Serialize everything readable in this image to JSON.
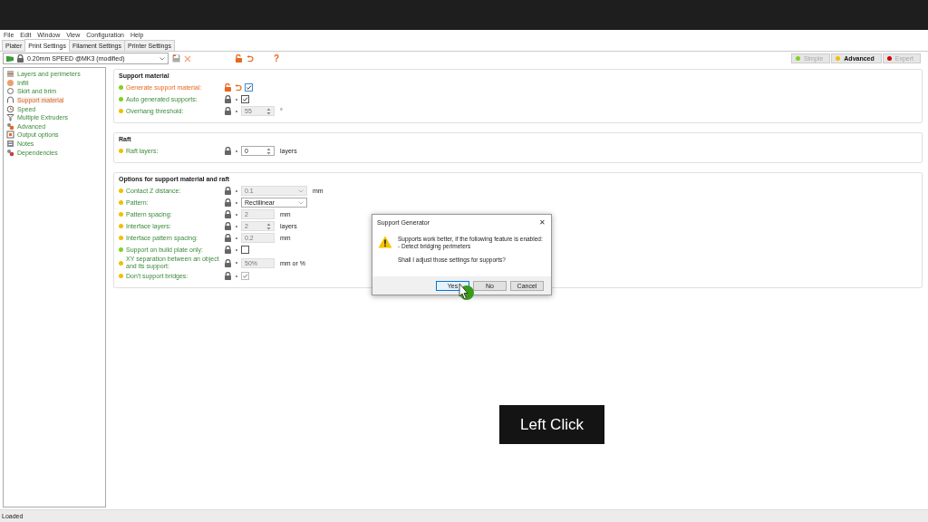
{
  "menu": [
    "File",
    "Edit",
    "Window",
    "View",
    "Configuration",
    "Help"
  ],
  "tabs": [
    {
      "label": "Plater",
      "selected": false
    },
    {
      "label": "Print Settings",
      "selected": true
    },
    {
      "label": "Filament Settings",
      "selected": false
    },
    {
      "label": "Printer Settings",
      "selected": false
    }
  ],
  "preset": {
    "value": "0.20mm SPEED @MK3 (modified)"
  },
  "help_glyph": "?",
  "modes": [
    {
      "label": "Simple",
      "color": "#7fd320",
      "selected": false
    },
    {
      "label": "Advanced",
      "color": "#f0c000",
      "selected": true
    },
    {
      "label": "Expert",
      "color": "#d00000",
      "selected": false
    }
  ],
  "sidebar": {
    "items": [
      {
        "label": "Layers and perimeters",
        "selected": false
      },
      {
        "label": "Infill",
        "selected": false
      },
      {
        "label": "Skirt and brim",
        "selected": false
      },
      {
        "label": "Support material",
        "selected": true
      },
      {
        "label": "Speed",
        "selected": false
      },
      {
        "label": "Multiple Extruders",
        "selected": false
      },
      {
        "label": "Advanced",
        "selected": false
      },
      {
        "label": "Output options",
        "selected": false
      },
      {
        "label": "Notes",
        "selected": false
      },
      {
        "label": "Dependencies",
        "selected": false
      }
    ]
  },
  "groups": [
    {
      "title": "Support material",
      "options": [
        {
          "kind": "checkbox",
          "label": "Generate support material:",
          "color": "#7fd320",
          "modified": true,
          "checked": true,
          "disabled": false
        },
        {
          "kind": "checkbox",
          "label": "Auto generated supports:",
          "color": "#7fd320",
          "modified": false,
          "checked": true,
          "disabled": false
        },
        {
          "kind": "spin",
          "label": "Overhang threshold:",
          "color": "#f0c000",
          "modified": false,
          "value": "55",
          "unit": "°",
          "disabled": true
        }
      ]
    },
    {
      "title": "Raft",
      "options": [
        {
          "kind": "spin",
          "label": "Raft layers:",
          "color": "#f0c000",
          "modified": false,
          "value": "0",
          "unit": "layers",
          "disabled": false
        }
      ]
    },
    {
      "title": "Options for support material and raft",
      "options": [
        {
          "kind": "combo",
          "label": "Contact Z distance:",
          "color": "#f0c000",
          "modified": false,
          "value": "0.1",
          "unit": "mm",
          "disabled": true
        },
        {
          "kind": "combo",
          "label": "Pattern:",
          "color": "#f0c000",
          "modified": false,
          "value": "Rectilinear",
          "disabled": false
        },
        {
          "kind": "text",
          "label": "Pattern spacing:",
          "color": "#f0c000",
          "modified": false,
          "value": "2",
          "unit": "mm",
          "disabled": true
        },
        {
          "kind": "spin",
          "label": "Interface layers:",
          "color": "#f0c000",
          "modified": false,
          "value": "2",
          "unit": "layers",
          "disabled": true
        },
        {
          "kind": "text",
          "label": "Interface pattern spacing:",
          "color": "#f0c000",
          "modified": false,
          "value": "0.2",
          "unit": "mm",
          "disabled": true
        },
        {
          "kind": "checkbox",
          "label": "Support on build plate only:",
          "color": "#7fd320",
          "modified": false,
          "checked": false,
          "disabled": false
        },
        {
          "kind": "text",
          "label": "XY separation between an object and its support:",
          "color": "#f0c000",
          "modified": false,
          "value": "50%",
          "unit": "mm or %",
          "disabled": true
        },
        {
          "kind": "checkbox",
          "label": "Don't support bridges:",
          "color": "#f0c000",
          "modified": false,
          "checked": true,
          "disabled": true
        }
      ]
    }
  ],
  "dialog": {
    "title": "Support Generator",
    "close_glyph": "✕",
    "message_lines": [
      "Supports work better, if the following feature is enabled:",
      "- Detect bridging perimeters"
    ],
    "question": "Shall I adjust those settings for supports?",
    "buttons": [
      {
        "label": "Yes",
        "selected": true
      },
      {
        "label": "No",
        "selected": false
      },
      {
        "label": "Cancel",
        "selected": false
      }
    ]
  },
  "caption": "Left Click",
  "status_bar": {
    "text": "Loaded"
  }
}
